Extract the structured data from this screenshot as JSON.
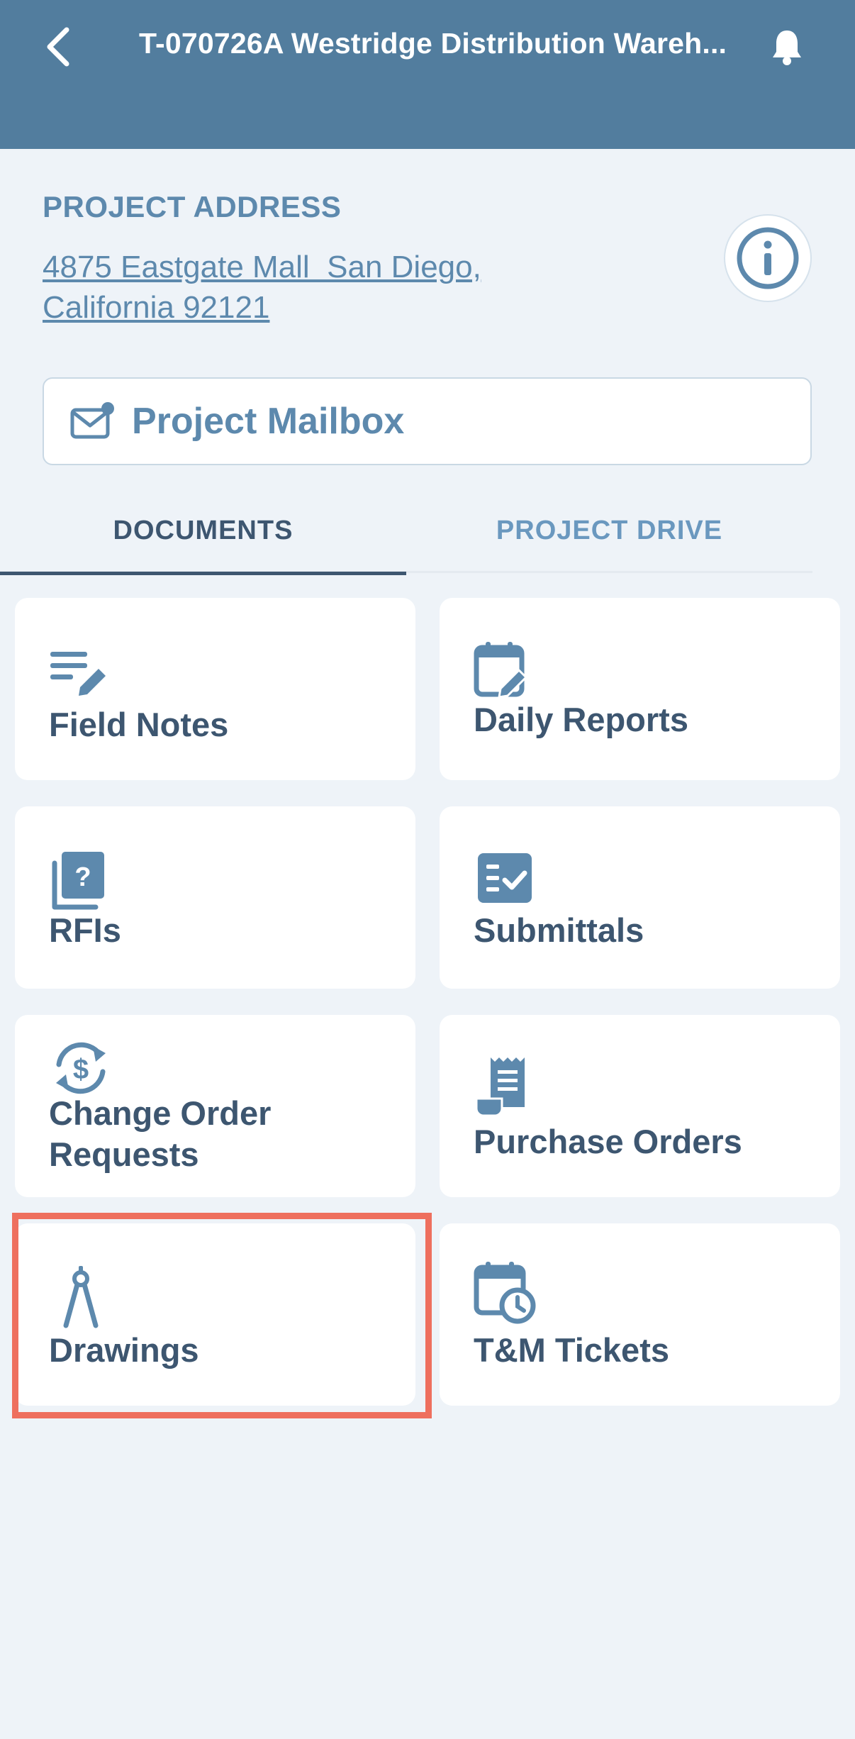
{
  "header": {
    "title": "T-070726A Westridge Distribution Wareh...",
    "back_icon": "chevron-left-icon",
    "bell_icon": "bell-icon",
    "background_color": "#527d9e"
  },
  "project": {
    "address_label": "PROJECT ADDRESS",
    "address_line1": "4875 Eastgate Mall  San Diego,",
    "address_line2": "California 92121",
    "info_icon": "info-icon"
  },
  "mailbox": {
    "label": "Project Mailbox",
    "icon": "mail-icon"
  },
  "tabs": [
    {
      "label": "DOCUMENTS",
      "active": true
    },
    {
      "label": "PROJECT DRIVE",
      "active": false
    }
  ],
  "cards": [
    {
      "label": "Field Notes",
      "icon": "notes-edit-icon"
    },
    {
      "label": "Daily Reports",
      "icon": "calendar-edit-icon"
    },
    {
      "label": "RFIs",
      "icon": "question-doc-icon"
    },
    {
      "label": "Submittals",
      "icon": "checklist-icon"
    },
    {
      "label": "Change Order\nRequests",
      "icon": "dollar-cycle-icon"
    },
    {
      "label": "Purchase Orders",
      "icon": "receipt-icon"
    },
    {
      "label": "Drawings",
      "icon": "compass-drawing-icon",
      "highlighted": true
    },
    {
      "label": "T&M Tickets",
      "icon": "calendar-clock-icon"
    }
  ],
  "colors": {
    "accent": "#5d89ad",
    "text_dark": "#3d5670",
    "highlight": "#ee6f5e",
    "page_bg": "#eef3f8"
  }
}
